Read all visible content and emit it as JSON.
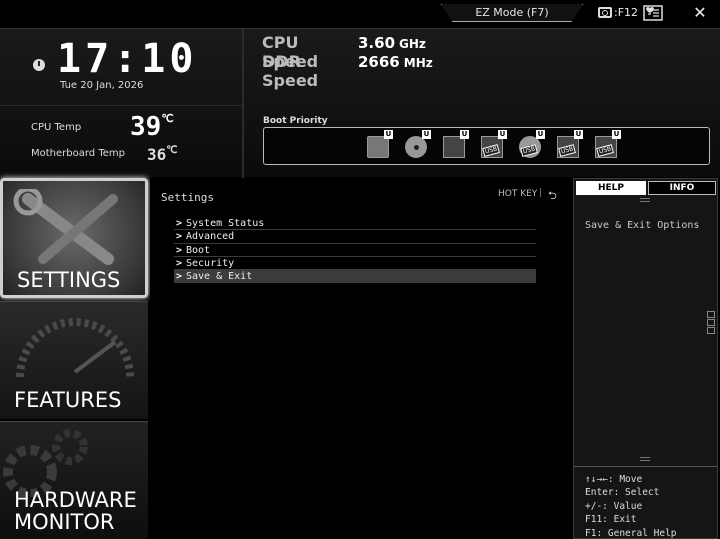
{
  "topbar": {
    "ez_mode_label": "EZ Mode (F7)",
    "screenshot_label": ":F12",
    "close_glyph": "✕"
  },
  "clock": {
    "time": "17:10",
    "date": "Tue  20 Jan, 2026"
  },
  "temps": {
    "cpu_label": "CPU Temp",
    "cpu_value": "39",
    "cpu_unit": "℃",
    "mb_label": "Motherboard Temp",
    "mb_value": "36",
    "mb_unit": "℃"
  },
  "speeds": {
    "cpu_label": "CPU Speed",
    "cpu_value": "3.60",
    "cpu_unit": "GHz",
    "ddr_label": "DDR Speed",
    "ddr_value": "2666",
    "ddr_unit": "MHz"
  },
  "boot": {
    "label": "Boot Priority",
    "devices": [
      {
        "icon": "hdd-icon",
        "badge": "U"
      },
      {
        "icon": "cd-icon",
        "badge": "U"
      },
      {
        "icon": "floppy-icon",
        "badge": "U"
      },
      {
        "icon": "usb-icon",
        "badge": "U",
        "tag": "USB"
      },
      {
        "icon": "usb-cd-icon",
        "badge": "U",
        "tag": "USB"
      },
      {
        "icon": "usb-floppy-icon",
        "badge": "U",
        "tag": "USB"
      },
      {
        "icon": "usb-drive-icon",
        "badge": "U",
        "tag": "USB"
      }
    ]
  },
  "nav": {
    "settings": "SETTINGS",
    "features": "FEATURES",
    "hw_line1": "HARDWARE",
    "hw_line2": "MONITOR"
  },
  "main": {
    "title": "Settings",
    "hotkey": "HOT KEY",
    "hotkey_sep": "|",
    "back_glyph": "⮌",
    "menu": [
      {
        "label": "System Status"
      },
      {
        "label": "Advanced"
      },
      {
        "label": "Boot"
      },
      {
        "label": "Security"
      },
      {
        "label": "Save & Exit"
      }
    ]
  },
  "help": {
    "tab_help": "HELP",
    "tab_info": "INFO",
    "text": "Save & Exit Options",
    "keys": [
      "↑↓→←: Move",
      "Enter: Select",
      "+/-: Value",
      "F11: Exit",
      "F1: General Help"
    ]
  },
  "colors": {
    "background": "#000000",
    "selected_row": "#3c3c3c",
    "accent_white": "#ffffff"
  }
}
